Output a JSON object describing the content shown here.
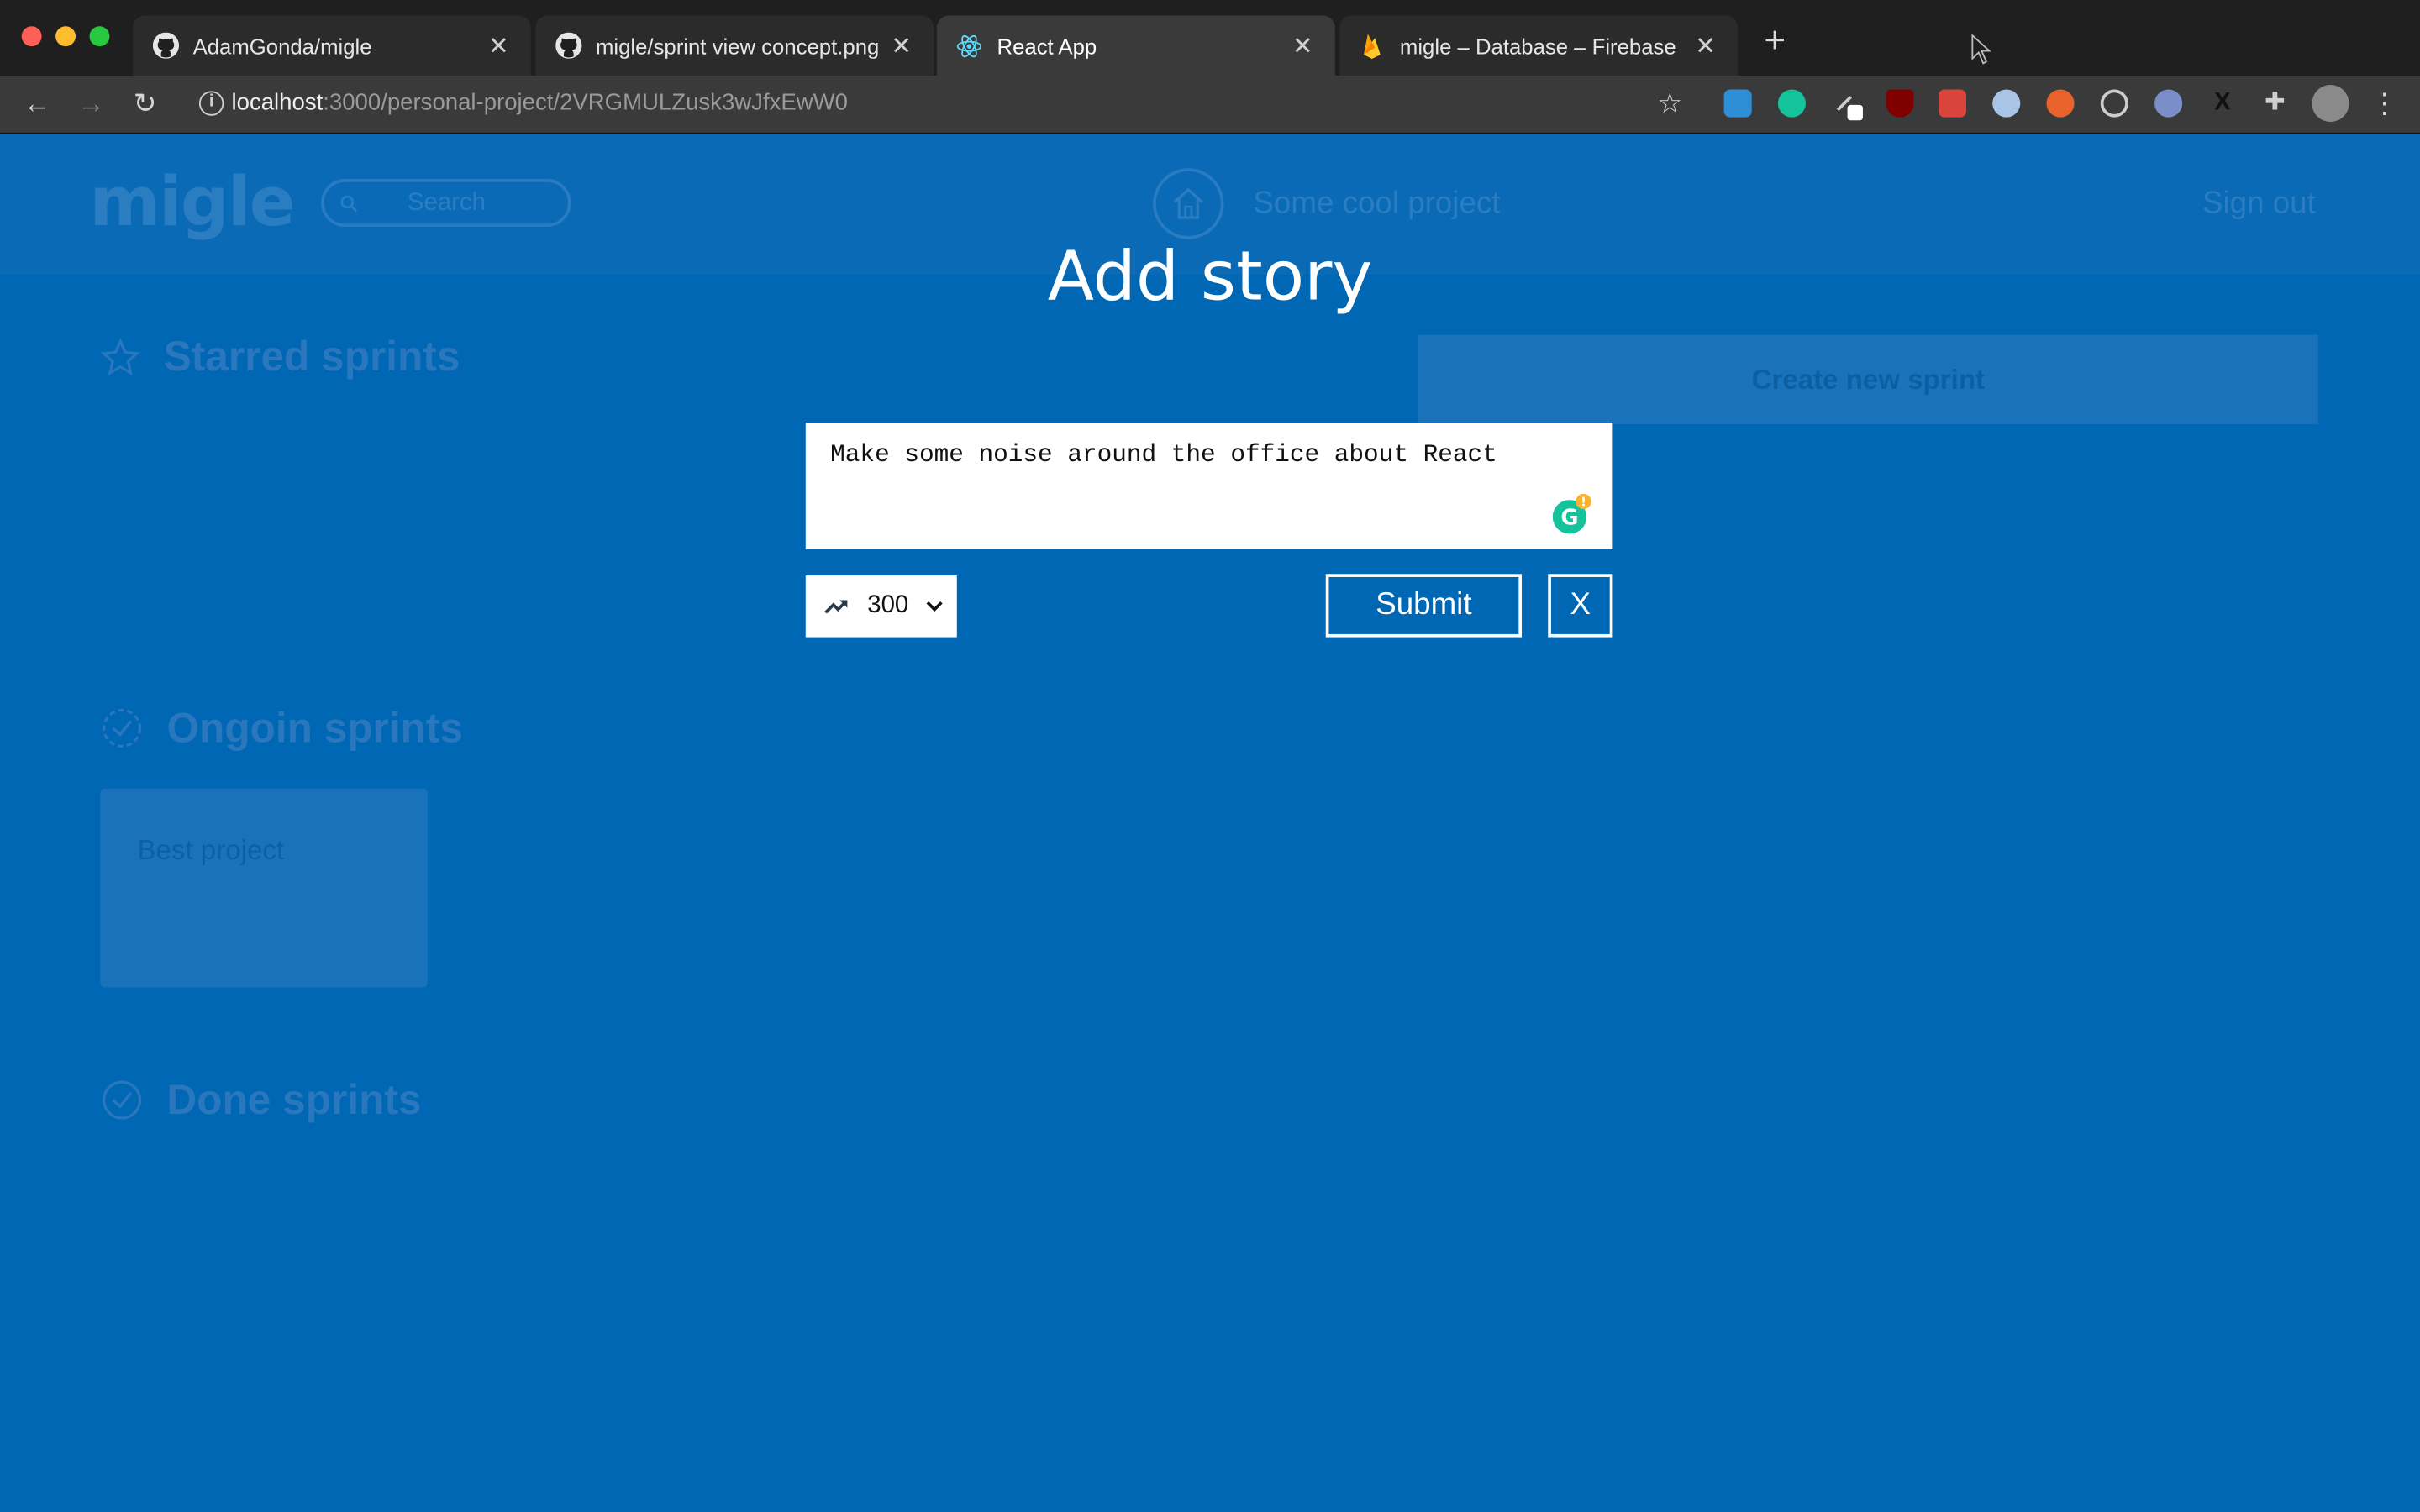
{
  "browser": {
    "tabs": [
      {
        "title": "AdamGonda/migle",
        "icon": "github-icon",
        "active": false
      },
      {
        "title": "migle/sprint view concept.png",
        "icon": "github-icon",
        "active": false
      },
      {
        "title": "React App",
        "icon": "react-icon",
        "active": true
      },
      {
        "title": "migle – Database – Firebase co",
        "icon": "firebase-icon",
        "active": false
      }
    ],
    "url_host": "localhost",
    "url_path": ":3000/personal-project/2VRGMULZusk3wJfxEwW0"
  },
  "app": {
    "logo": "migle",
    "search_placeholder": "Search",
    "project_name": "Some cool project",
    "sign_out": "Sign out",
    "starred_title": "Starred sprints",
    "create_sprint": "Create new sprint",
    "ongoing_title": "Ongoin sprints",
    "ongoing_card": "Best project",
    "done_title": "Done sprints"
  },
  "modal": {
    "title": "Add story",
    "story_text": "Make some noise around the office about React",
    "points_value": "300",
    "submit_label": "Submit",
    "close_label": "X"
  },
  "colors": {
    "page_bg": "#0067b4",
    "accent": "#ffffff"
  }
}
